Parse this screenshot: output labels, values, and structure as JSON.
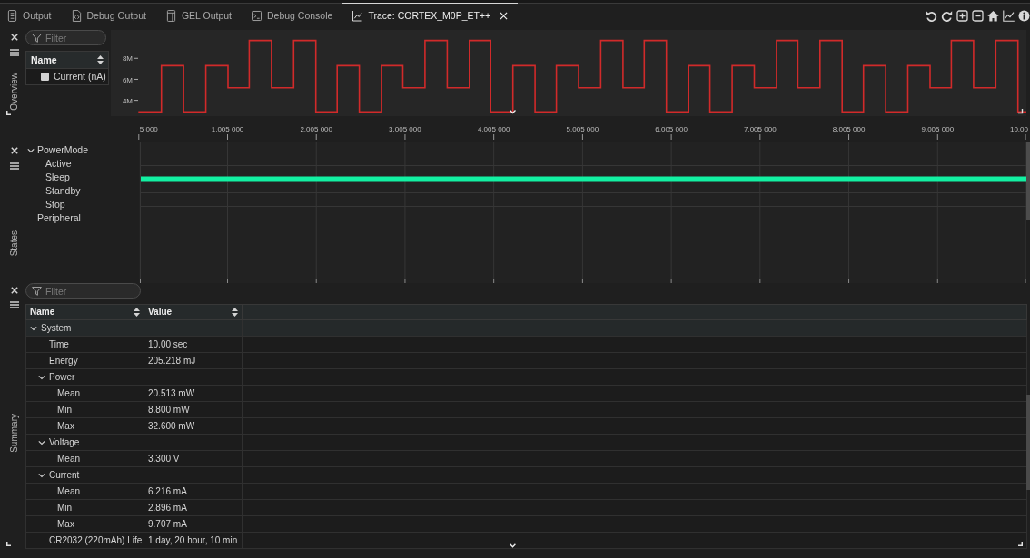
{
  "tabs": [
    {
      "label": "Output",
      "kind": "log",
      "selected": false
    },
    {
      "label": "Debug Output",
      "kind": "debug",
      "selected": false
    },
    {
      "label": "GEL Output",
      "kind": "script",
      "selected": false
    },
    {
      "label": "Debug Console",
      "kind": "console",
      "selected": false
    },
    {
      "label": "Trace: CORTEX_M0P_ET++",
      "kind": "trace",
      "selected": true
    }
  ],
  "overview": {
    "title": "Overview",
    "filter": {
      "placeholder": "Filter"
    },
    "legend": {
      "columns": [
        "Name"
      ],
      "rows": [
        {
          "name": "Current (nA)",
          "checked": false
        }
      ]
    },
    "chart_data": {
      "type": "step",
      "color": "#d12a2a",
      "x": [
        0,
        0.26,
        0.51,
        0.76,
        1.01,
        1.25,
        1.5,
        1.75,
        2.0,
        2.24,
        2.49,
        2.74,
        2.98,
        3.23,
        3.48,
        3.73,
        3.97,
        4.22,
        4.47,
        4.71,
        4.96,
        5.21,
        5.46,
        5.7,
        5.95,
        6.2,
        6.44,
        6.69,
        6.94,
        7.19,
        7.43,
        7.68,
        7.93,
        8.17,
        8.42,
        8.67,
        8.92,
        9.16,
        9.41,
        9.66,
        9.91,
        10.005
      ],
      "values": [
        2900000,
        7300000,
        2900000,
        7300000,
        5200000,
        9700000,
        5200000,
        9700000,
        2900000,
        7300000,
        2900000,
        7300000,
        5200000,
        9700000,
        5200000,
        9700000,
        2900000,
        7300000,
        2900000,
        7300000,
        5200000,
        9700000,
        5200000,
        9700000,
        2900000,
        7300000,
        2900000,
        7300000,
        5200000,
        9700000,
        5200000,
        9700000,
        2900000,
        7300000,
        2900000,
        7300000,
        5200000,
        9700000,
        5200000,
        9700000,
        2900000,
        2900000
      ],
      "xlim": [
        -0.31,
        10.005
      ],
      "ylim": [
        2500000,
        10700000
      ],
      "xticks": [
        {
          "value": 1.005,
          "label": "1.005 000"
        },
        {
          "value": 2.005,
          "label": "2.005 000"
        },
        {
          "value": 3.005,
          "label": "3.005 000"
        },
        {
          "value": 4.005,
          "label": "4.005 000"
        },
        {
          "value": 5.005,
          "label": "5.005 000"
        },
        {
          "value": 6.005,
          "label": "6.005 000"
        },
        {
          "value": 7.005,
          "label": "7.005 000"
        },
        {
          "value": 8.005,
          "label": "8.005 000"
        },
        {
          "value": 9.005,
          "label": "9.005 000"
        }
      ],
      "yticks": [
        {
          "value": 4000000,
          "label": "4M"
        },
        {
          "value": 6000000,
          "label": "6M"
        },
        {
          "value": 8000000,
          "label": "8M"
        }
      ]
    },
    "axis_edge_labels": [
      "5 000",
      "10.00"
    ]
  },
  "states": {
    "title": "States",
    "tree": [
      {
        "label": "PowerMode",
        "expanded": true,
        "children": [
          {
            "label": "Active",
            "active": false
          },
          {
            "label": "Sleep",
            "active": true
          },
          {
            "label": "Standby",
            "active": false
          },
          {
            "label": "Stop",
            "active": false
          }
        ]
      },
      {
        "label": "Peripheral"
      }
    ]
  },
  "summary": {
    "title": "Summary",
    "filter": {
      "placeholder": "Filter"
    },
    "columns": [
      "Name",
      "Value"
    ],
    "rows": [
      {
        "name": "System",
        "expanded": true,
        "children": [
          {
            "name": "Time",
            "value": "10.00 sec"
          },
          {
            "name": "Energy",
            "value": "205.218 mJ"
          },
          {
            "name": "Power",
            "expanded": true,
            "children": [
              {
                "name": "Mean",
                "value": "20.513 mW"
              },
              {
                "name": "Min",
                "value": "8.800 mW"
              },
              {
                "name": "Max",
                "value": "32.600 mW"
              }
            ]
          },
          {
            "name": "Voltage",
            "expanded": true,
            "children": [
              {
                "name": "Mean",
                "value": "3.300 V"
              }
            ]
          },
          {
            "name": "Current",
            "expanded": true,
            "children": [
              {
                "name": "Mean",
                "value": "6.216 mA"
              },
              {
                "name": "Min",
                "value": "2.896 mA"
              },
              {
                "name": "Max",
                "value": "9.707 mA"
              }
            ]
          },
          {
            "name": "CR2032 (220mAh) Life",
            "value": "1 day, 20 hour, 10 min"
          }
        ]
      }
    ]
  }
}
